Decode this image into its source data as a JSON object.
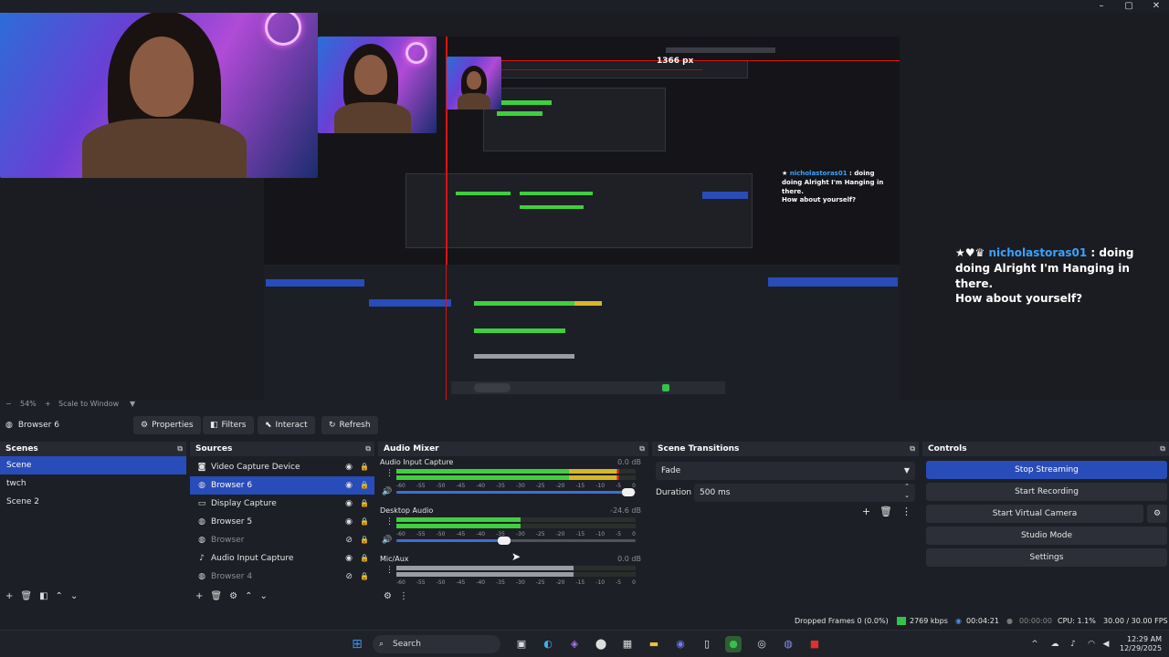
{
  "window_controls": {
    "minimize": "–",
    "maximize": "▢",
    "close": "✕"
  },
  "preview": {
    "measure_label": "1366 px",
    "chat": {
      "username": "nicholastoras01",
      "separator": ":",
      "message_line1": "doing",
      "message_line2": "doing Alright I'm Hanging in there.",
      "message_line3": "How about yourself?"
    },
    "mini_chat": {
      "username": "nicholastoras01",
      "separator": ":",
      "message_line1": "doing",
      "message_line2": "doing Alright I'm Hanging in there.",
      "message_line3": "How about yourself?"
    }
  },
  "zoom": {
    "value": "54%",
    "mode": "Scale to Window"
  },
  "toolbar": {
    "source_name": "Browser 6",
    "properties": "Properties",
    "filters": "Filters",
    "interact": "Interact",
    "refresh": "Refresh"
  },
  "scenes": {
    "title": "Scenes",
    "items": [
      {
        "label": "Scene",
        "selected": true
      },
      {
        "label": "twch",
        "selected": false
      },
      {
        "label": "Scene 2",
        "selected": false
      }
    ]
  },
  "sources": {
    "title": "Sources",
    "items": [
      {
        "label": "Video Capture Device",
        "icon": "camera-icon",
        "glyph": "◙",
        "visible": true,
        "selected": false
      },
      {
        "label": "Browser 6",
        "icon": "globe-icon",
        "glyph": "◍",
        "visible": true,
        "selected": true
      },
      {
        "label": "Display Capture",
        "icon": "monitor-icon",
        "glyph": "▭",
        "visible": true,
        "selected": false
      },
      {
        "label": "Browser 5",
        "icon": "globe-icon",
        "glyph": "◍",
        "visible": true,
        "selected": false
      },
      {
        "label": "Browser",
        "icon": "globe-icon",
        "glyph": "◍",
        "visible": false,
        "selected": false
      },
      {
        "label": "Audio Input Capture",
        "icon": "microphone-icon",
        "glyph": "♪",
        "visible": true,
        "selected": false
      },
      {
        "label": "Browser 4",
        "icon": "globe-icon",
        "glyph": "◍",
        "visible": false,
        "selected": false
      }
    ]
  },
  "mixer": {
    "title": "Audio Mixer",
    "scale": [
      "-60",
      "-55",
      "-50",
      "-45",
      "-40",
      "-35",
      "-30",
      "-25",
      "-20",
      "-15",
      "-10",
      "-5",
      "0"
    ],
    "channels": [
      {
        "name": "Audio Input Capture",
        "db": "0.0 dB",
        "level": 0.93,
        "peak": 0.97,
        "volume": 0.97
      },
      {
        "name": "Desktop Audio",
        "db": "-24.6 dB",
        "level": 0.52,
        "peak": 0.6,
        "volume": 0.45
      },
      {
        "name": "Mic/Aux",
        "db": "0.0 dB",
        "level": 0.74,
        "peak": 0.8,
        "volume": 0.0
      }
    ]
  },
  "transitions": {
    "title": "Scene Transitions",
    "selected": "Fade",
    "duration_label": "Duration",
    "duration_value": "500 ms"
  },
  "controls": {
    "title": "Controls",
    "stop_streaming": "Stop Streaming",
    "start_recording": "Start Recording",
    "start_virtual_camera": "Start Virtual Camera",
    "studio_mode": "Studio Mode",
    "settings": "Settings"
  },
  "status": {
    "dropped_frames": "Dropped Frames 0 (0.0%)",
    "bitrate": "2769 kbps",
    "stream_time": "00:04:21",
    "record_time": "00:00:00",
    "cpu": "CPU: 1.1%",
    "fps": "30.00 / 30.00 FPS"
  },
  "taskbar": {
    "search_placeholder": "Search",
    "time": "12:29 AM",
    "date": "12/29/2025"
  },
  "colors": {
    "accent": "#284cb8",
    "meter_green": "#3fcf3f",
    "meter_yellow": "#d6b62a",
    "meter_red": "#c0222a",
    "live_green": "#34c34a"
  }
}
